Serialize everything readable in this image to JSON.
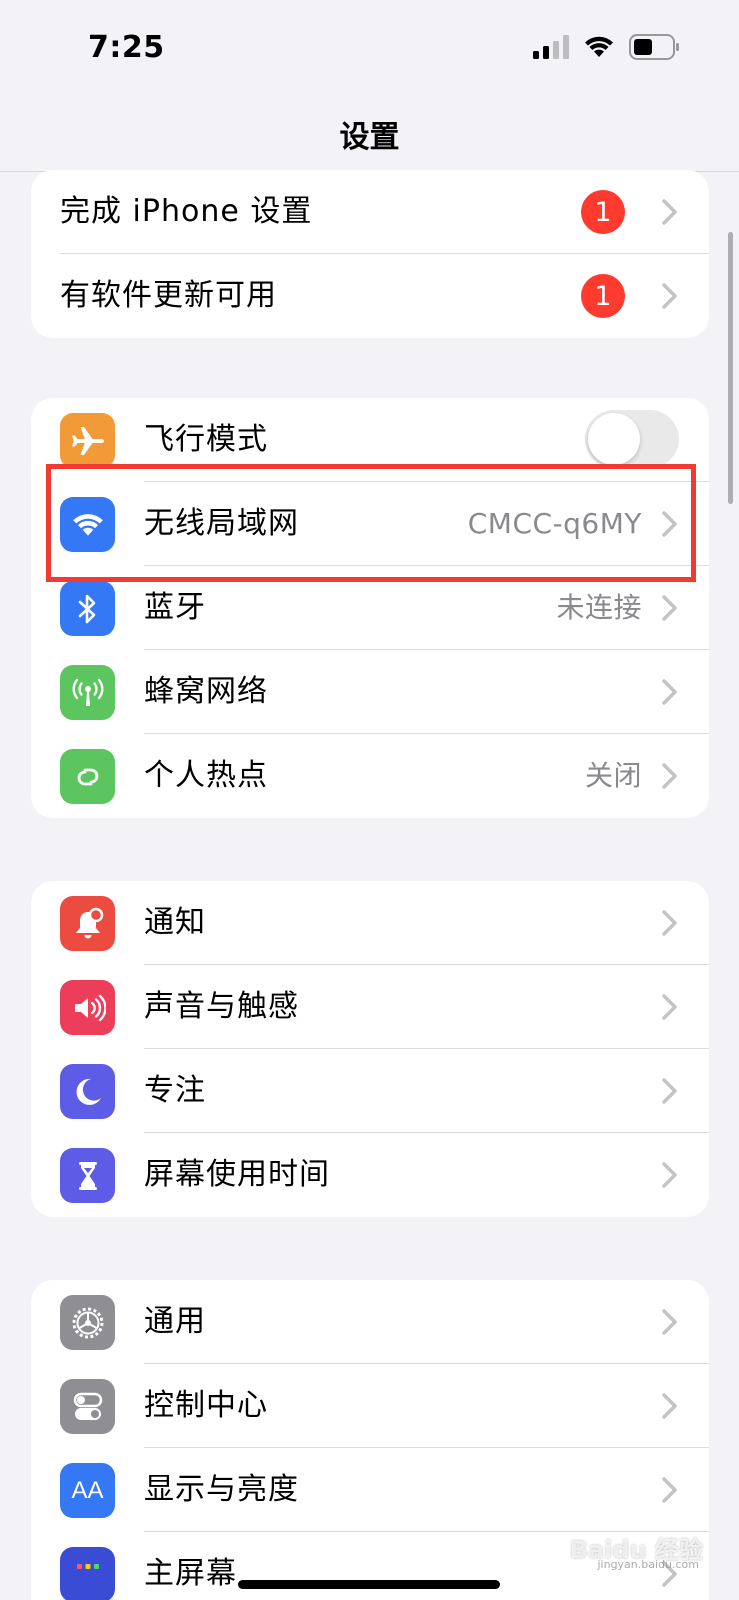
{
  "status_bar": {
    "time": "7:25",
    "signal_icon": "cellular-signal-icon",
    "wifi_icon": "wifi-icon",
    "battery_icon": "battery-icon"
  },
  "nav": {
    "title": "设置"
  },
  "setup_group": [
    {
      "label": "完成 iPhone 设置",
      "badge": "1"
    },
    {
      "label": "有软件更新可用",
      "badge": "1"
    }
  ],
  "connectivity_group": {
    "airplane": {
      "label": "飞行模式",
      "icon": "airplane-icon",
      "color": "#f19a37",
      "on": false
    },
    "wifi": {
      "label": "无线局域网",
      "value": "CMCC-q6MY",
      "icon": "wifi-icon",
      "color": "#3478f6"
    },
    "bluetooth": {
      "label": "蓝牙",
      "value": "未连接",
      "icon": "bluetooth-icon",
      "color": "#3478f6"
    },
    "cellular": {
      "label": "蜂窝网络",
      "icon": "cellular-antenna-icon",
      "color": "#5dc560"
    },
    "hotspot": {
      "label": "个人热点",
      "value": "关闭",
      "icon": "hotspot-icon",
      "color": "#5dc560"
    }
  },
  "notifications_group": {
    "notifications": {
      "label": "通知",
      "icon": "notification-bell-icon",
      "color": "#ec4b3f"
    },
    "sounds": {
      "label": "声音与触感",
      "icon": "speaker-icon",
      "color": "#ec3d5a"
    },
    "focus": {
      "label": "专注",
      "icon": "moon-icon",
      "color": "#5d5ce6"
    },
    "screen_time": {
      "label": "屏幕使用时间",
      "icon": "hourglass-icon",
      "color": "#5d5ce6"
    }
  },
  "general_group": {
    "general": {
      "label": "通用",
      "icon": "gear-icon",
      "color": "#8e8e93"
    },
    "control_center": {
      "label": "控制中心",
      "icon": "switches-icon",
      "color": "#8e8e93"
    },
    "display": {
      "label": "显示与亮度",
      "icon": "text-size-icon",
      "color": "#3478f6",
      "icon_text": "AA"
    },
    "home_screen": {
      "label": "主屏幕",
      "icon": "home-screen-grid-icon",
      "color": "#3a4bd6"
    }
  },
  "watermark": {
    "text": "Baidu 经验",
    "sub": "jingyan.baidu.com"
  }
}
